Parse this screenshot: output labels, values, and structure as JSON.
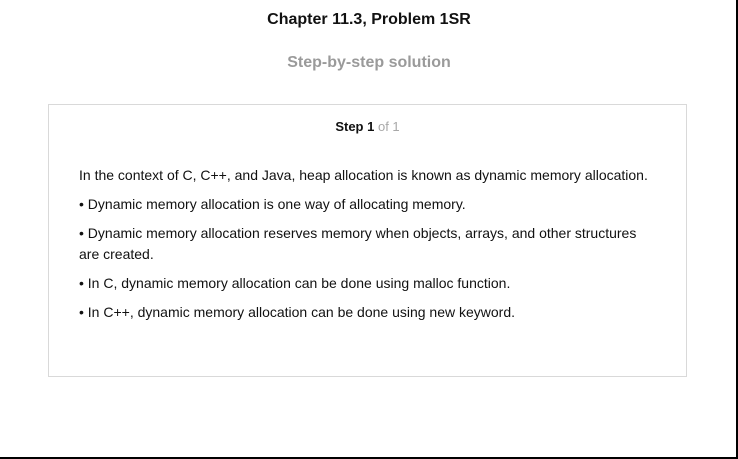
{
  "header": {
    "chapter_title": "Chapter 11.3, Problem 1SR",
    "subtitle": "Step-by-step solution"
  },
  "step": {
    "label": "Step 1",
    "of_text": "of 1",
    "paragraphs": [
      "In the context of C, C++, and Java, heap allocation is known as dynamic memory allocation.",
      "• Dynamic memory allocation is one way of allocating memory.",
      "• Dynamic memory allocation reserves memory when objects, arrays, and other structures are created.",
      "• In C, dynamic memory allocation can be done using malloc function.",
      "• In C++, dynamic memory allocation can be done using new keyword."
    ]
  },
  "colors": {
    "subtitle": "#9a9a9a",
    "card_border": "#d9d9d9",
    "step_of": "#a8a8a8"
  }
}
